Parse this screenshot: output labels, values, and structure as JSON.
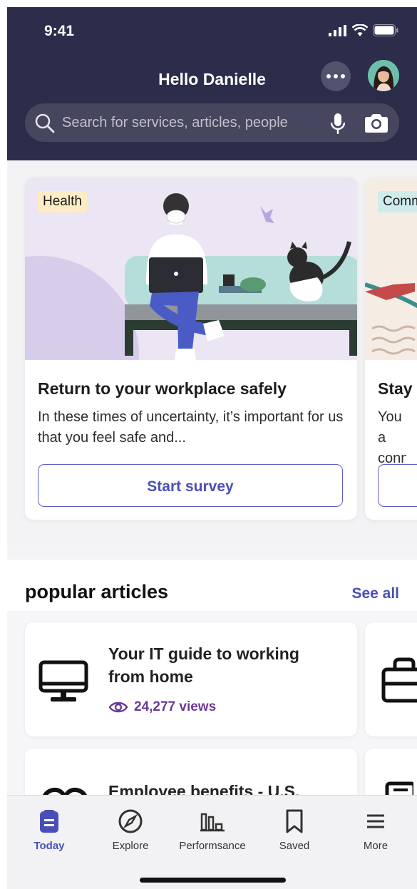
{
  "status_bar": {
    "time": "9:41"
  },
  "header": {
    "greeting": "Hello Danielle",
    "search": {
      "placeholder": "Search for services, articles, people"
    }
  },
  "cards": [
    {
      "tag": "Health",
      "title": "Return to your workplace safely",
      "description": "In these times of uncertainty, it’s important for us that you feel safe and...",
      "button": "Start survey"
    },
    {
      "tag": "Comm",
      "title": "Stay",
      "description": "You a conne",
      "button": ""
    }
  ],
  "articles_section": {
    "title": "popular articles",
    "see_all": "See all",
    "items": [
      {
        "title": "Your IT guide to working from home",
        "views": "24,277 views",
        "icon": "monitor-icon"
      },
      {
        "title": "Employee benefits - U.S.",
        "views": "",
        "icon": "heart-icon"
      }
    ]
  },
  "tab_bar": {
    "items": [
      {
        "label": "Today",
        "icon": "today-icon",
        "active": true
      },
      {
        "label": "Explore",
        "icon": "compass-icon",
        "active": false
      },
      {
        "label": "Performsance",
        "icon": "chart-icon",
        "active": false
      },
      {
        "label": "Saved",
        "icon": "bookmark-icon",
        "active": false
      },
      {
        "label": "More",
        "icon": "menu-icon",
        "active": false
      }
    ]
  },
  "colors": {
    "header_bg": "#2c2c4b",
    "accent": "#4a4fb8",
    "views": "#6c3a96"
  }
}
